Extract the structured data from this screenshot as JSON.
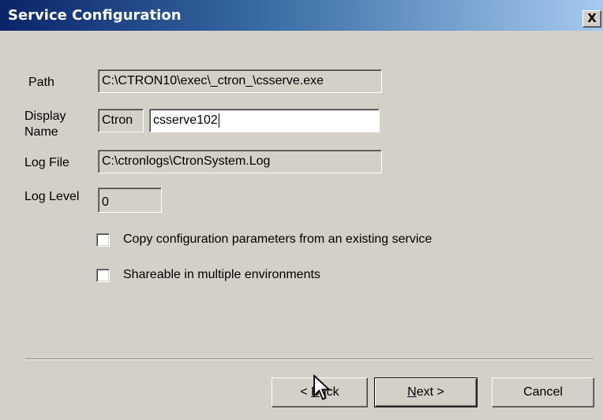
{
  "window": {
    "title": "Service Configuration",
    "close_glyph": "X"
  },
  "form": {
    "path": {
      "label": "Path",
      "value": "C:\\CTRON10\\exec\\_ctron_\\csserve.exe"
    },
    "display_name": {
      "label_line1": "Display",
      "label_line2": "Name",
      "prefix": "Ctron",
      "value": "csserve102"
    },
    "log_file": {
      "label": "Log File",
      "value": "C:\\ctronlogs\\CtronSystem.Log"
    },
    "log_level": {
      "label": "Log Level",
      "value": "0"
    }
  },
  "options": {
    "copy_config": {
      "label": "Copy configuration parameters from an existing service",
      "checked": false
    },
    "shareable": {
      "label": "Shareable in multiple environments",
      "checked": false
    }
  },
  "buttons": {
    "back": {
      "prefix": "< ",
      "mnemonic": "B",
      "rest": "ack"
    },
    "next": {
      "mnemonic": "N",
      "rest": "ext >"
    },
    "cancel": {
      "label": "Cancel"
    }
  },
  "icons": {
    "cursor": "arrow-cursor-icon"
  },
  "colors": {
    "titlebar_start": "#0a246a",
    "titlebar_end": "#a6caf0",
    "face": "#d4d0c8"
  }
}
